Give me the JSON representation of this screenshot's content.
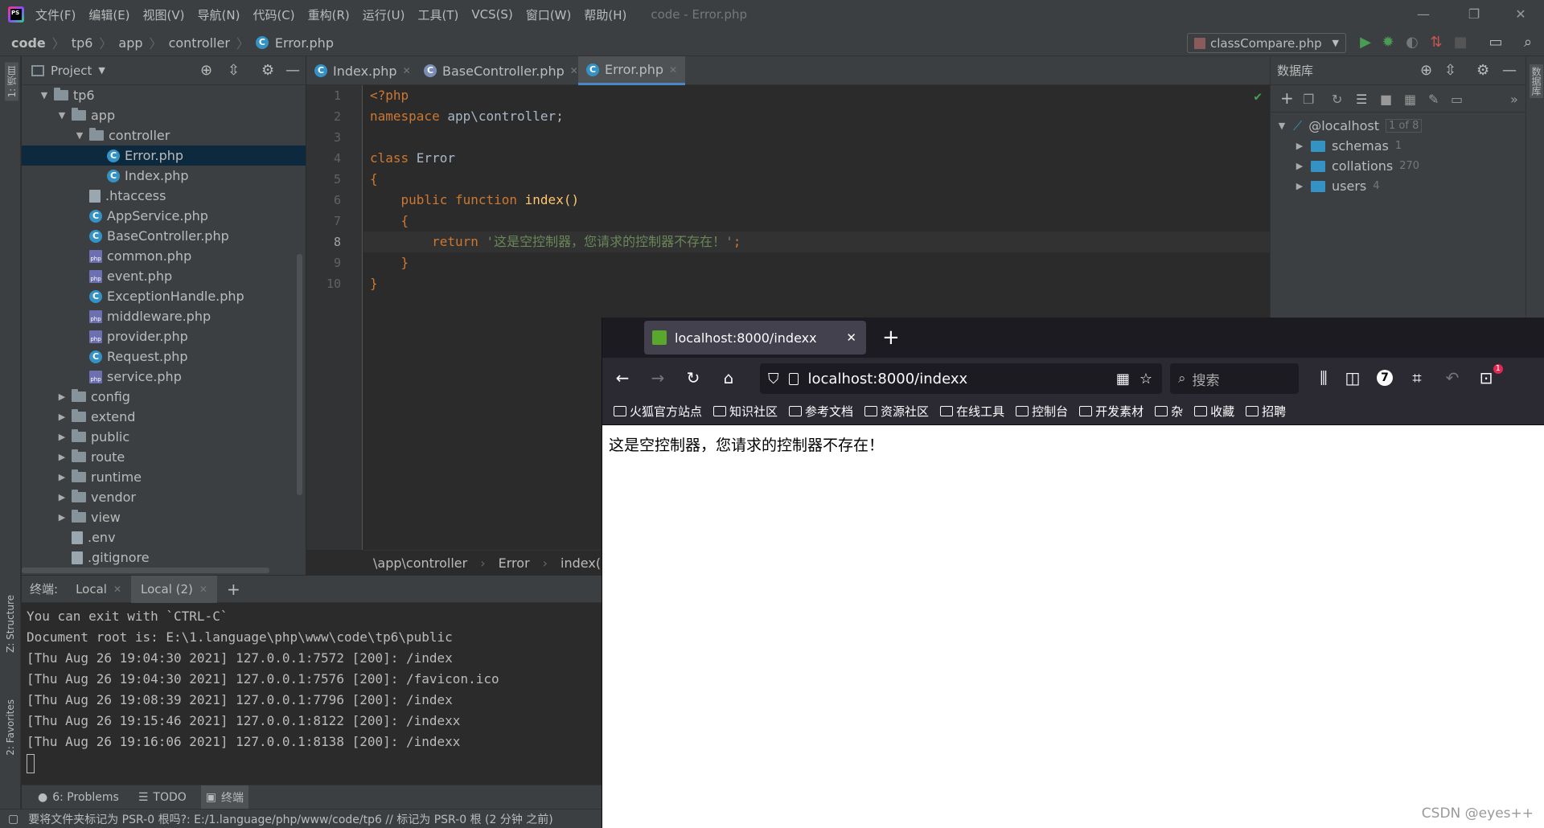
{
  "titlebar": {
    "menu": [
      "文件(F)",
      "编辑(E)",
      "视图(V)",
      "导航(N)",
      "代码(C)",
      "重构(R)",
      "运行(U)",
      "工具(T)",
      "VCS(S)",
      "窗口(W)",
      "帮助(H)"
    ],
    "window_title": "code - Error.php"
  },
  "navbar": {
    "crumbs": [
      "code",
      "tp6",
      "app",
      "controller",
      "Error.php"
    ],
    "run_config": "classCompare.php"
  },
  "left_stripe": {
    "project_label": "1: 项目",
    "structure_label": "Z: Structure",
    "favorites_label": "2: Favorites"
  },
  "project": {
    "title": "Project",
    "tree": [
      {
        "label": "tp6",
        "type": "folder",
        "expanded": true,
        "depth": 0
      },
      {
        "label": "app",
        "type": "folder",
        "expanded": true,
        "depth": 1
      },
      {
        "label": "controller",
        "type": "folder",
        "expanded": true,
        "depth": 2
      },
      {
        "label": "Error.php",
        "type": "class",
        "depth": 3,
        "selected": true
      },
      {
        "label": "Index.php",
        "type": "class",
        "depth": 3
      },
      {
        "label": ".htaccess",
        "type": "dot",
        "depth": 2
      },
      {
        "label": "AppService.php",
        "type": "class",
        "depth": 2
      },
      {
        "label": "BaseController.php",
        "type": "class",
        "depth": 2
      },
      {
        "label": "common.php",
        "type": "php",
        "depth": 2
      },
      {
        "label": "event.php",
        "type": "php",
        "depth": 2
      },
      {
        "label": "ExceptionHandle.php",
        "type": "class",
        "depth": 2
      },
      {
        "label": "middleware.php",
        "type": "php",
        "depth": 2
      },
      {
        "label": "provider.php",
        "type": "php",
        "depth": 2
      },
      {
        "label": "Request.php",
        "type": "class",
        "depth": 2
      },
      {
        "label": "service.php",
        "type": "php",
        "depth": 2
      },
      {
        "label": "config",
        "type": "folder",
        "depth": 1
      },
      {
        "label": "extend",
        "type": "folder",
        "depth": 1
      },
      {
        "label": "public",
        "type": "folder",
        "depth": 1
      },
      {
        "label": "route",
        "type": "folder",
        "depth": 1
      },
      {
        "label": "runtime",
        "type": "folder",
        "depth": 1
      },
      {
        "label": "vendor",
        "type": "folder",
        "depth": 1
      },
      {
        "label": "view",
        "type": "folder",
        "depth": 1
      },
      {
        "label": ".env",
        "type": "dot",
        "depth": 1
      },
      {
        "label": ".gitignore",
        "type": "dot",
        "depth": 1
      }
    ]
  },
  "editor": {
    "tabs": [
      {
        "label": "Index.php",
        "active": false
      },
      {
        "label": "BaseController.php",
        "active": false
      },
      {
        "label": "Error.php",
        "active": true
      }
    ],
    "line_numbers": [
      "1",
      "2",
      "3",
      "4",
      "5",
      "6",
      "7",
      "8",
      "9",
      "10"
    ],
    "code": {
      "l1": "<?php",
      "l2_kw": "namespace ",
      "l2_rest": "app\\controller;",
      "l4_kw": "class ",
      "l4_rest": "Error",
      "l5": "{",
      "l6_kw": "    public function ",
      "l6_fn": "index",
      "l6_rest": "()",
      "l7": "    {",
      "l8_kw": "        return ",
      "l8_str": "'这是空控制器，您请求的控制器不存在！'",
      "l8_end": ";",
      "l9": "    }",
      "l10": "}"
    },
    "breadcrumb": [
      "\\app\\controller",
      "Error",
      "index()"
    ]
  },
  "database": {
    "title": "数据库",
    "host": "@localhost",
    "host_count": "1 of 8",
    "items": [
      {
        "label": "schemas",
        "count": "1"
      },
      {
        "label": "collations",
        "count": "270"
      },
      {
        "label": "users",
        "count": "4"
      }
    ],
    "stripe_label": "数据库"
  },
  "terminal": {
    "label": "终端:",
    "tabs": [
      "Local",
      "Local (2)"
    ],
    "lines": [
      "You can exit with `CTRL-C`",
      "Document root is: E:\\1.language\\php\\www\\code\\tp6\\public",
      "[Thu Aug 26 19:04:30 2021] 127.0.0.1:7572 [200]: /index",
      "[Thu Aug 26 19:04:30 2021] 127.0.0.1:7576 [200]: /favicon.ico",
      "[Thu Aug 26 19:08:39 2021] 127.0.0.1:7796 [200]: /index",
      "[Thu Aug 26 19:15:46 2021] 127.0.0.1:8122 [200]: /indexx",
      "[Thu Aug 26 19:16:06 2021] 127.0.0.1:8138 [200]: /indexx"
    ]
  },
  "bottom_tools": [
    "6: Problems",
    "TODO",
    "终端"
  ],
  "status": "要将文件夹标记为 PSR-0 根吗?: E:/1.language/php/www/code/tp6 // 标记为 PSR-0 根 (2 分钟 之前)",
  "browser": {
    "tab_title": "localhost:8000/indexx",
    "url": "localhost:8000/indexx",
    "search_placeholder": "搜索",
    "bookmarks": [
      "火狐官方站点",
      "知识社区",
      "参考文档",
      "资源社区",
      "在线工具",
      "控制台",
      "开发素材",
      "杂",
      "收藏",
      "招聘"
    ],
    "page_text": "这是空控制器，您请求的控制器不存在！",
    "badge_count": "7",
    "notif_count": "1"
  },
  "watermark": "CSDN @eyes++",
  "colors": {
    "accent": "#4a88c7",
    "selection": "#0d293e",
    "run_green": "#499c54",
    "firefox_dark": "#2b2a33"
  }
}
